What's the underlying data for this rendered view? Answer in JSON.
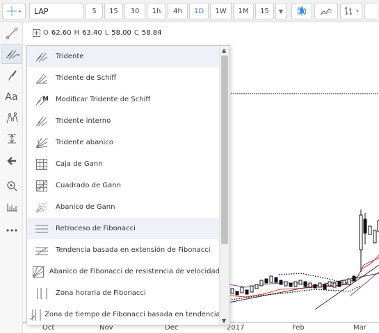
{
  "toolbar": {
    "symbol": "LAP",
    "intervals": [
      {
        "label": "5",
        "active": false
      },
      {
        "label": "15",
        "active": false
      },
      {
        "label": "30",
        "active": false
      },
      {
        "label": "1h",
        "active": false
      },
      {
        "label": "4h",
        "active": false
      },
      {
        "label": "1D",
        "active": true
      },
      {
        "label": "1W",
        "active": false
      },
      {
        "label": "1M",
        "active": false
      },
      {
        "label": "15",
        "active": false
      }
    ],
    "icons": [
      "chevron-down-icon",
      "candlestick-icon",
      "line-chart-icon",
      "indicator-icon"
    ]
  },
  "sidebar": {
    "tools": [
      "crosshair-icon",
      "trend-line-icon",
      "pitchfork-icon",
      "brush-icon",
      "text-icon",
      "pattern-icon",
      "measure-icon",
      "back-arrow-icon",
      "zoom-icon",
      "ruler-icon",
      "more-icon"
    ],
    "text_tool_label": "Aa"
  },
  "ohlc": {
    "o_label": "O",
    "o": "62.60",
    "h_label": "H",
    "h": "63.40",
    "l_label": "L",
    "l": "58.00",
    "c_label": "C",
    "c": "58.84"
  },
  "xaxis": {
    "labels": [
      "Oct",
      "Nov",
      "Dec",
      "2017",
      "Feb",
      "Mar"
    ]
  },
  "dropdown": {
    "items": [
      {
        "label": "Tridente",
        "icon": "pitchfork-icon"
      },
      {
        "label": "Tridente de Schiff",
        "icon": "schiff-pitchfork-icon"
      },
      {
        "label": "Modificar Tridente de Schiff",
        "icon": "modified-schiff-pitchfork-icon"
      },
      {
        "label": "Tridente interno",
        "icon": "inside-pitchfork-icon"
      },
      {
        "label": "Tridente abanico",
        "icon": "pitchfan-icon"
      },
      {
        "label": "Caja de Gann",
        "icon": "gann-box-icon"
      },
      {
        "label": "Cuadrado de Gann",
        "icon": "gann-square-icon"
      },
      {
        "label": "Abanico de Gann",
        "icon": "gann-fan-icon"
      },
      {
        "label": "Retroceso de Fibonacci",
        "icon": "fib-retracement-icon"
      },
      {
        "label": "Tendencia basada en extensión de Fibonacci",
        "icon": "fib-extension-icon"
      },
      {
        "label": "Abanico de Fibonacci de resistencia de velocidad",
        "icon": "fib-speed-fan-icon"
      },
      {
        "label": "Zona horaria de Fibonacci",
        "icon": "fib-timezone-icon"
      },
      {
        "label": "Zona de tiempo de Fibonacci basada en tendencia",
        "icon": "trend-fib-time-icon"
      }
    ]
  },
  "colors": {
    "accent": "#4a90d9",
    "up_candle": "#ffffff",
    "down_candle": "#111111",
    "ma_red": "#e53935",
    "ma_purple": "#8e44ad"
  }
}
